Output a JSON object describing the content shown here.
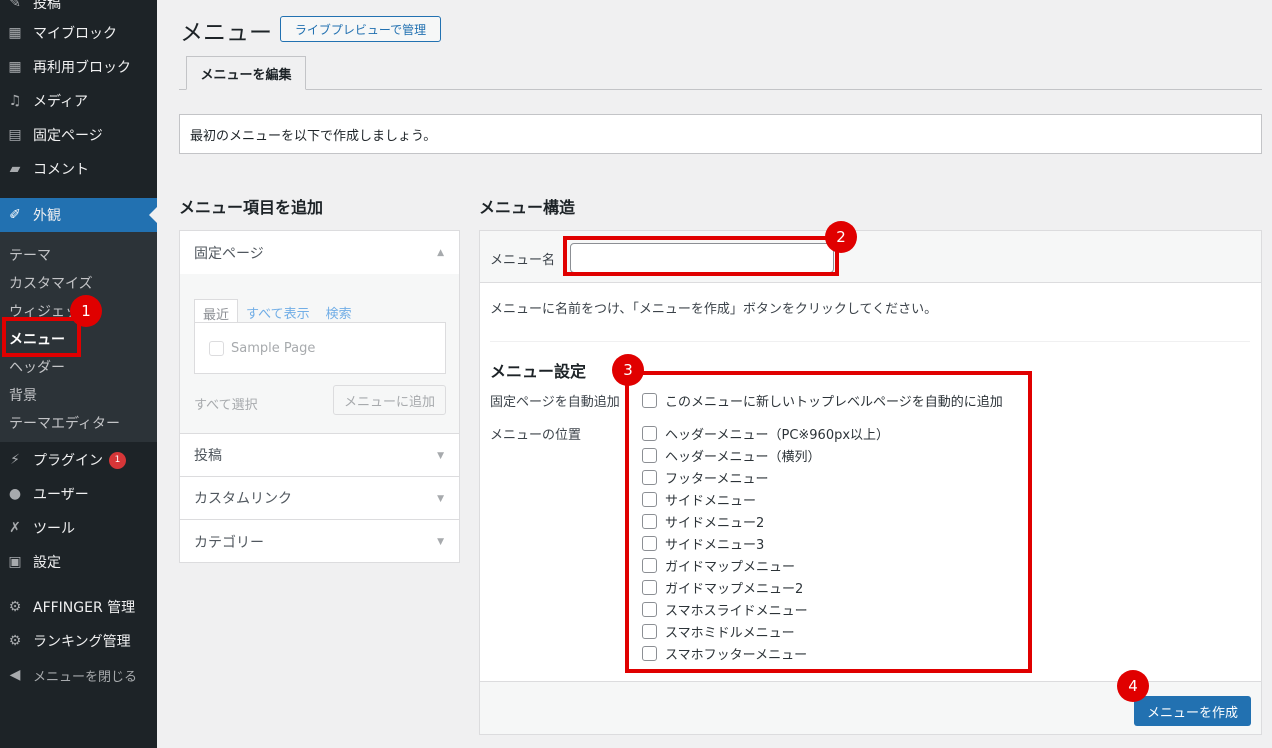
{
  "sidebar": {
    "items": [
      {
        "label": "投稿",
        "icon": "pin-icon"
      },
      {
        "label": "マイブロック",
        "icon": "grid-icon"
      },
      {
        "label": "再利用ブロック",
        "icon": "grid-icon"
      },
      {
        "label": "メディア",
        "icon": "media-icon"
      },
      {
        "label": "固定ページ",
        "icon": "page-icon"
      },
      {
        "label": "コメント",
        "icon": "comment-icon"
      },
      {
        "label": "外観",
        "icon": "brush-icon"
      },
      {
        "label": "プラグイン",
        "icon": "plugin-icon",
        "badge": "1"
      },
      {
        "label": "ユーザー",
        "icon": "user-icon"
      },
      {
        "label": "ツール",
        "icon": "wrench-icon"
      },
      {
        "label": "設定",
        "icon": "settings-icon"
      },
      {
        "label": "AFFINGER 管理",
        "icon": "gear-icon"
      },
      {
        "label": "ランキング管理",
        "icon": "gear-icon"
      },
      {
        "label": "メニューを閉じる",
        "icon": "collapse-icon"
      }
    ],
    "submenu": [
      "テーマ",
      "カスタマイズ",
      "ウィジェット",
      "メニュー",
      "ヘッダー",
      "背景",
      "テーマエディター"
    ]
  },
  "header": {
    "title": "メニュー",
    "live_preview_button": "ライブプレビューで管理",
    "tab": "メニューを編集"
  },
  "notice": "最初のメニューを以下で作成しましょう。",
  "add_items": {
    "heading": "メニュー項目を追加",
    "sections": [
      "固定ページ",
      "投稿",
      "カスタムリンク",
      "カテゴリー"
    ],
    "tabs": [
      "最近",
      "すべて表示",
      "検索"
    ],
    "sample_page": "Sample Page",
    "select_all": "すべて選択",
    "add_button": "メニューに追加"
  },
  "structure": {
    "heading": "メニュー構造",
    "menu_name_label": "メニュー名",
    "menu_name_value": "",
    "instruction": "メニューに名前をつけ、「メニューを作成」ボタンをクリックしてください。",
    "settings_heading": "メニュー設定",
    "auto_add_label": "固定ページを自動追加",
    "auto_add_option": "このメニューに新しいトップレベルページを自動的に追加",
    "location_label": "メニューの位置",
    "locations": [
      "ヘッダーメニュー（PC※960px以上）",
      "ヘッダーメニュー（横列）",
      "フッターメニュー",
      "サイドメニュー",
      "サイドメニュー2",
      "サイドメニュー3",
      "ガイドマップメニュー",
      "ガイドマップメニュー2",
      "スマホスライドメニュー",
      "スマホミドルメニュー",
      "スマホフッターメニュー"
    ],
    "create_button": "メニューを作成"
  },
  "annotations": [
    "1",
    "2",
    "3",
    "4"
  ],
  "colors": {
    "sidebar": "#1d2327",
    "accent": "#2271b1",
    "highlight": "#e00000"
  }
}
